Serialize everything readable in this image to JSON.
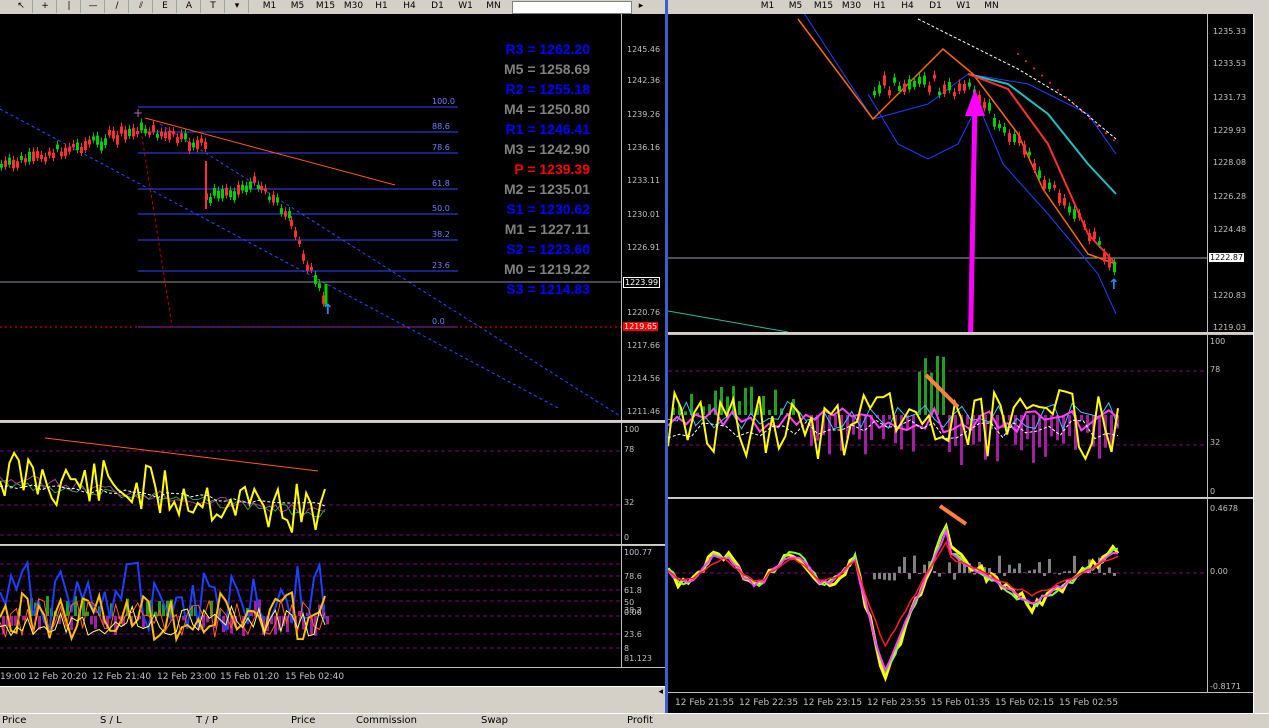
{
  "toolbar": {
    "icon_buttons": [
      "cursor-icon",
      "crosshair-icon",
      "vertical-line-icon",
      "horizontal-line-icon",
      "trendline-icon",
      "equidistant-channel-icon",
      "fibo-icon",
      "text-icon",
      "label-icon",
      "arrows-icon"
    ],
    "icon_glyphs": [
      "↖",
      "+",
      "|",
      "—",
      "/",
      "⫽",
      "E",
      "A",
      "T",
      "▾"
    ],
    "timeframes": [
      "M1",
      "M5",
      "M15",
      "M30",
      "H1",
      "H4",
      "D1",
      "W1",
      "MN"
    ],
    "right_timeframes": [
      "M1",
      "M5",
      "M15",
      "M30",
      "H1",
      "H4",
      "D1",
      "W1",
      "MN"
    ]
  },
  "left_chart": {
    "pivot_levels": [
      {
        "label": "R3 = 1262.20",
        "color": "#0000ff"
      },
      {
        "label": "M5 = 1258.69",
        "color": "#808080"
      },
      {
        "label": "R2 = 1255.18",
        "color": "#0000ff"
      },
      {
        "label": "M4 = 1250.80",
        "color": "#808080"
      },
      {
        "label": "R1 = 1246.41",
        "color": "#0000ff"
      },
      {
        "label": "M3 = 1242.90",
        "color": "#808080"
      },
      {
        "label": "P  = 1239.39",
        "color": "#ff0000"
      },
      {
        "label": "M2 = 1235.01",
        "color": "#808080"
      },
      {
        "label": "S1 = 1230.62",
        "color": "#0000ff"
      },
      {
        "label": "M1 = 1227.11",
        "color": "#808080"
      },
      {
        "label": "S2 = 1223.60",
        "color": "#0000ff"
      },
      {
        "label": "M0 = 1219.22",
        "color": "#808080"
      },
      {
        "label": "S3 = 1214.83",
        "color": "#0000ff"
      }
    ],
    "fib_levels": [
      "100.0",
      "88.6",
      "78.6",
      "61.8",
      "50.0",
      "38.2",
      "23.6",
      "0.0"
    ],
    "price_axis": [
      "1245.46",
      "1242.36",
      "1239.26",
      "1236.16",
      "1233.11",
      "1230.01",
      "1226.91",
      "1220.76",
      "1217.66",
      "1214.56",
      "1211.46"
    ],
    "current_price": "1223.99",
    "red_price": "1219.65",
    "osc1_axis": [
      "100",
      "78",
      "32",
      "0"
    ],
    "osc2_axis": [
      "100.77",
      "78.6",
      "61.8",
      "50",
      "38.2",
      "23.6",
      "8",
      "81.123",
      "0.00"
    ],
    "time_axis": [
      "19:00",
      "12 Feb 20:20",
      "12 Feb 21:40",
      "12 Feb 23:00",
      "15 Feb 01:20",
      "15 Feb 02:40"
    ]
  },
  "right_chart": {
    "price_axis": [
      "1235.33",
      "1233.53",
      "1231.73",
      "1229.93",
      "1228.08",
      "1226.28",
      "1224.48",
      "1220.83",
      "1219.03"
    ],
    "current_price": "1222.87",
    "osc1_axis": [
      "100",
      "78",
      "32",
      "0"
    ],
    "osc2_axis": [
      "0.4678",
      "0.00",
      "-0.8171"
    ],
    "time_axis": [
      "12 Feb 21:55",
      "12 Feb 22:35",
      "12 Feb 23:15",
      "12 Feb 23:55",
      "15 Feb 01:35",
      "15 Feb 02:15",
      "15 Feb 02:55"
    ]
  },
  "terminal_columns": [
    "Price",
    "S / L",
    "T / P",
    "Price",
    "Commission",
    "Swap",
    "Profit"
  ]
}
